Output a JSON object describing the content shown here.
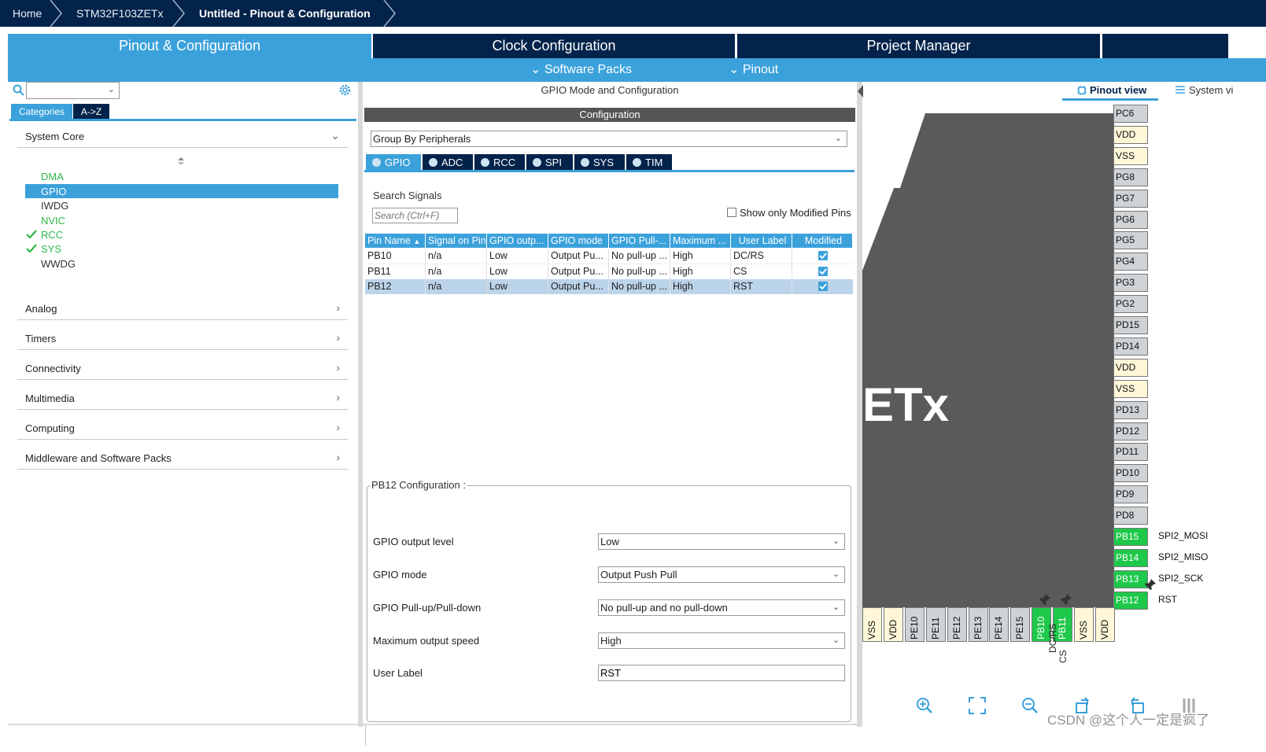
{
  "breadcrumb": {
    "home": "Home",
    "device": "STM32F103ZETx",
    "current": "Untitled - Pinout & Configuration"
  },
  "tabs": {
    "pinout": "Pinout & Configuration",
    "clock": "Clock Configuration",
    "project": "Project Manager"
  },
  "subbar": {
    "software_packs": "Software Packs",
    "pinout": "Pinout"
  },
  "left": {
    "tab_categories": "Categories",
    "tab_az": "A->Z",
    "system_core": "System Core",
    "items": [
      "DMA",
      "GPIO",
      "IWDG",
      "NVIC",
      "RCC",
      "SYS",
      "WWDG"
    ],
    "categories": [
      "Analog",
      "Timers",
      "Connectivity",
      "Multimedia",
      "Computing",
      "Middleware and Software Packs"
    ]
  },
  "center": {
    "title": "GPIO Mode and Configuration",
    "config_header": "Configuration",
    "group_by": "Group By Peripherals",
    "peripheral_tabs": [
      "GPIO",
      "ADC",
      "RCC",
      "SPI",
      "SYS",
      "TIM"
    ],
    "search_label": "Search Signals",
    "search_placeholder": "Search (Ctrl+F)",
    "show_modified": "Show only Modified Pins",
    "columns": [
      "Pin Name",
      "Signal on Pin",
      "GPIO outp...",
      "GPIO mode",
      "GPIO Pull-...",
      "Maximum ...",
      "User Label",
      "Modified"
    ],
    "rows": [
      [
        "PB10",
        "n/a",
        "Low",
        "Output Pu...",
        "No pull-up ...",
        "High",
        "DC/RS"
      ],
      [
        "PB11",
        "n/a",
        "Low",
        "Output Pu...",
        "No pull-up ...",
        "High",
        "CS"
      ],
      [
        "PB12",
        "n/a",
        "Low",
        "Output Pu...",
        "No pull-up ...",
        "High",
        "RST"
      ]
    ],
    "pb12_config": "PB12 Configuration :",
    "fields": {
      "output_level_label": "GPIO output level",
      "output_level": "Low",
      "mode_label": "GPIO mode",
      "mode": "Output Push Pull",
      "pull_label": "GPIO Pull-up/Pull-down",
      "pull": "No pull-up and no pull-down",
      "speed_label": "Maximum output speed",
      "speed": "High",
      "user_label_label": "User Label",
      "user_label": "RST"
    }
  },
  "right": {
    "pinout_view": "Pinout view",
    "system_view": "System vi",
    "chip_text": "ETx",
    "right_pins": [
      "PC6",
      "VDD",
      "VSS",
      "PG8",
      "PG7",
      "PG6",
      "PG5",
      "PG4",
      "PG3",
      "PG2",
      "PD15",
      "PD14",
      "VDD",
      "VSS",
      "PD13",
      "PD12",
      "PD11",
      "PD10",
      "PD9",
      "PD8",
      "PB15",
      "PB14",
      "PB13",
      "PB12"
    ],
    "right_signals": {
      "PB15": "SPI2_MOSI",
      "PB14": "SPI2_MISO",
      "PB13": "SPI2_SCK",
      "PB12": "RST"
    },
    "bottom_pins": [
      "VSS",
      "VDD",
      "PE10",
      "PE11",
      "PE12",
      "PE13",
      "PE14",
      "PE15",
      "PB10",
      "PB11",
      "VSS",
      "VDD"
    ],
    "bottom_signals": {
      "PB10": "DC/RS",
      "PB11": "CS"
    },
    "watermark": "CSDN @这个人一定是疯了"
  },
  "colors": {
    "navy": "#03234b",
    "accent": "#3ba1db",
    "pin_green": "#1ec94a"
  }
}
